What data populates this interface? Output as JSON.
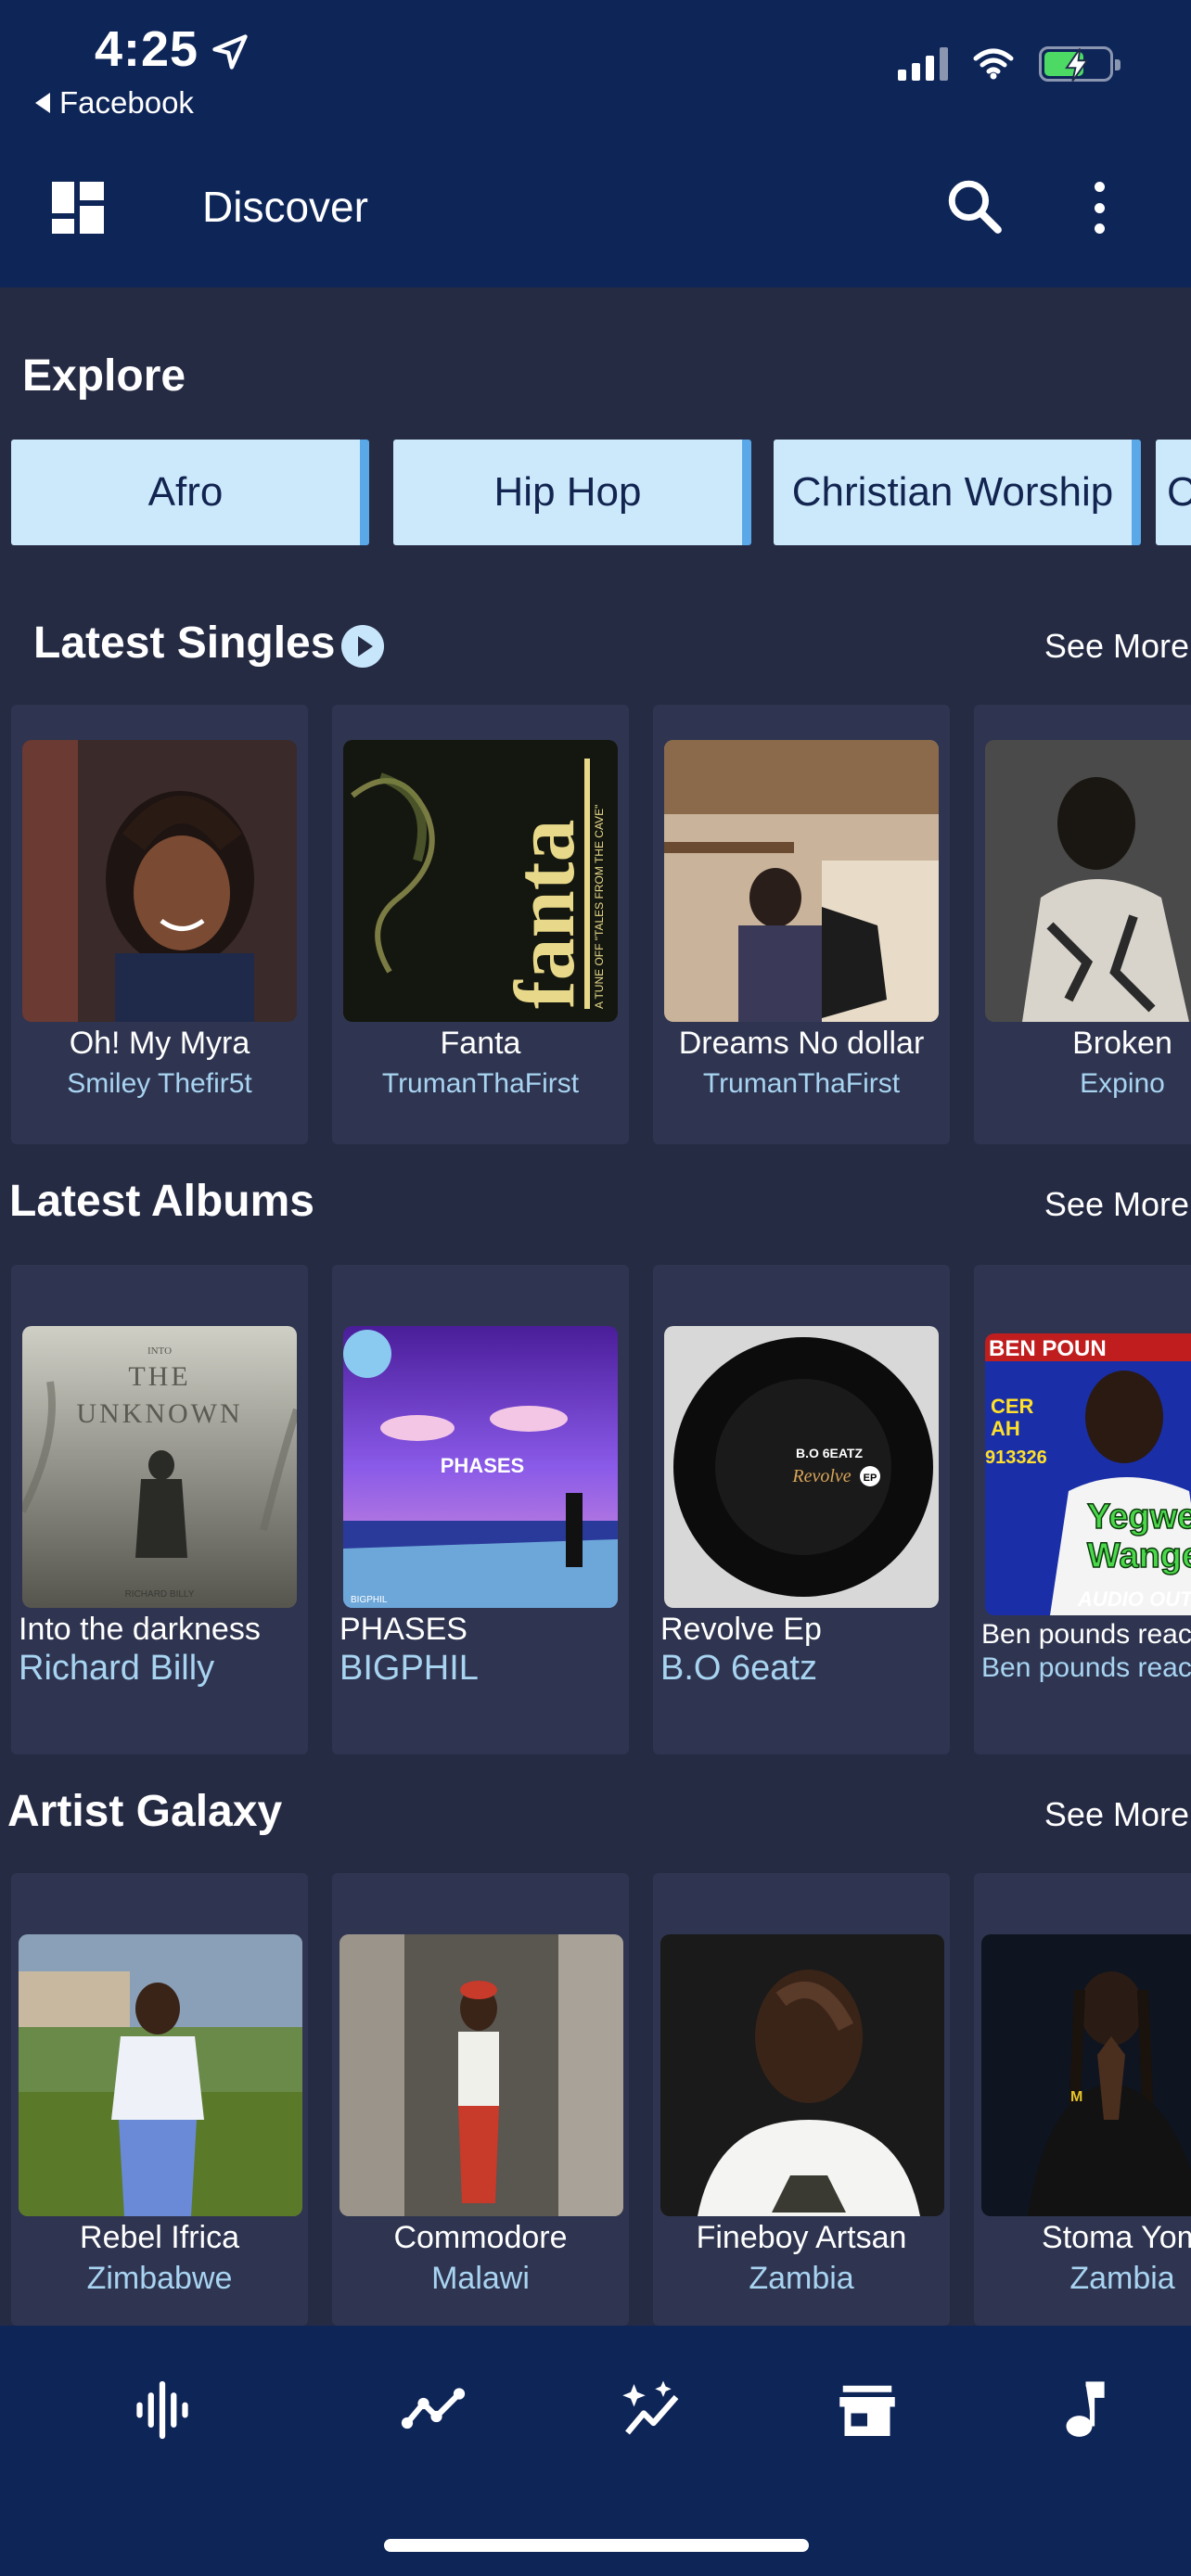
{
  "status_bar": {
    "time": "4:25",
    "back_app": "Facebook"
  },
  "header": {
    "title": "Discover"
  },
  "explore": {
    "title": "Explore",
    "chips": [
      "Afro",
      "Hip Hop",
      "Christian Worship",
      "C"
    ]
  },
  "singles": {
    "title": "Latest Singles",
    "see_more": "See More",
    "items": [
      {
        "title": "Oh! My Myra",
        "artist": "Smiley Thefir5t"
      },
      {
        "title": "Fanta",
        "artist": "TrumanThaFirst"
      },
      {
        "title": "Dreams No dollar",
        "artist": "TrumanThaFirst"
      },
      {
        "title": "Broken",
        "artist": "Expino"
      }
    ]
  },
  "albums": {
    "title": "Latest Albums",
    "see_more": "See More",
    "items": [
      {
        "title": "Into the darkness",
        "artist": "Richard Billy",
        "cover_text": [
          "INTO",
          "THE",
          "UNKNOWN",
          "RICHARD BILLY"
        ]
      },
      {
        "title": "PHASES",
        "artist": "BIGPHIL",
        "cover_text": [
          "PHASES",
          "BIGPHIL"
        ]
      },
      {
        "title": "Revolve Ep",
        "artist": "B.O 6eatz",
        "cover_text": [
          "B.O 6EATZ",
          "Revolve",
          "EP"
        ]
      },
      {
        "title": "Ben pounds reac",
        "artist": "Ben pounds reac",
        "cover_text": [
          "BEN POUN",
          "CER",
          "AH",
          "913326",
          "Yegwe",
          "Wange",
          "AUDIO OUT"
        ]
      }
    ]
  },
  "artists": {
    "title": "Artist Galaxy",
    "see_more": "See More",
    "items": [
      {
        "name": "Rebel Ifrica",
        "country": "Zimbabwe"
      },
      {
        "name": "Commodore",
        "country": "Malawi"
      },
      {
        "name": "Fineboy Artsan",
        "country": "Zambia"
      },
      {
        "name": "Stoma Yom",
        "country": "Zambia"
      }
    ]
  },
  "single_cover_text": {
    "fanta": "fanta",
    "fanta_side": "A TUNE OFF \"TALES FROM THE CAVE\""
  },
  "bottom_nav": {
    "items": [
      "waveform-icon",
      "trending-icon",
      "sparkle-icon",
      "store-icon",
      "music-note-icon"
    ]
  },
  "colors": {
    "header_bg": "#0e2558",
    "page_bg": "#262b44",
    "card_bg": "#2f3550",
    "chip_bg": "#cbe9fb",
    "accent_text": "#a8d4f2"
  }
}
